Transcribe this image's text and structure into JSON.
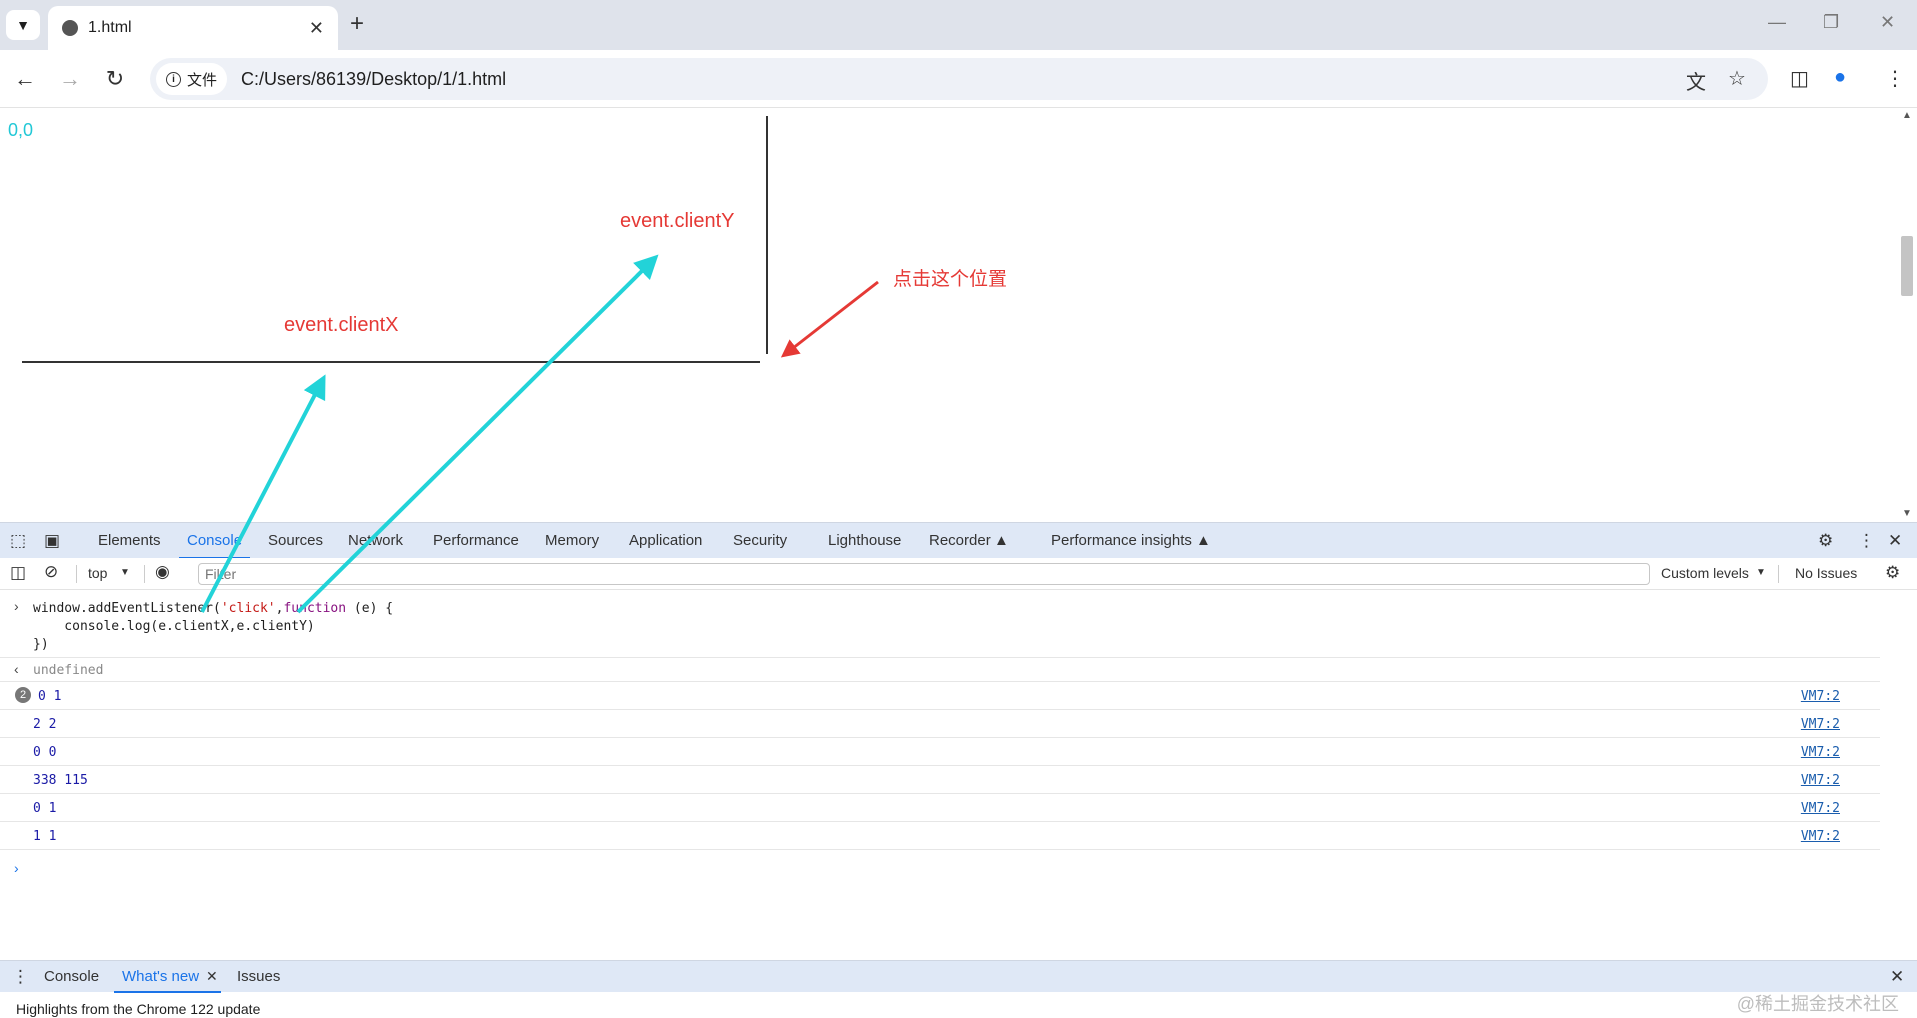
{
  "browser": {
    "tab_title": "1.html",
    "site_chip": "文件",
    "url": "C:/Users/86139/Desktop/1/1.html"
  },
  "page": {
    "coord_label": "0,0",
    "label_clienty": "event.clientY",
    "label_clientx": "event.clientX",
    "click_note": "点击这个位置"
  },
  "devtools": {
    "tabs": [
      "Elements",
      "Console",
      "Sources",
      "Network",
      "Performance",
      "Memory",
      "Application",
      "Security",
      "Lighthouse",
      "Recorder",
      "Performance insights"
    ],
    "active_tab": "Console",
    "context": "top",
    "filter_placeholder": "Filter",
    "levels": "Custom levels",
    "issues": "No Issues"
  },
  "console": {
    "code_line1_a": "window.addEventListener(",
    "code_line1_str": "'click'",
    "code_line1_b": ",",
    "code_line1_kw": "function",
    "code_line1_c": " (e) {",
    "code_line2": "    console.log(e.clientX,e.clientY)",
    "code_line3": "})",
    "result": "undefined",
    "logs": [
      {
        "text": "0 1",
        "count": "2",
        "source": "VM7:2"
      },
      {
        "text": "2 2",
        "source": "VM7:2"
      },
      {
        "text": "0 0",
        "source": "VM7:2"
      },
      {
        "text": "338 115",
        "source": "VM7:2"
      },
      {
        "text": "0 1",
        "source": "VM7:2"
      },
      {
        "text": "1 1",
        "source": "VM7:2"
      }
    ]
  },
  "drawer": {
    "tabs": [
      "Console",
      "What's new",
      "Issues"
    ],
    "active_tab": "What's new",
    "highlights": "Highlights from the Chrome 122 update"
  },
  "watermark": "@稀土掘金技术社区",
  "colors": {
    "cyan_arrow": "#22d3d8",
    "red_arrow": "#e53935",
    "accent": "#1a73e8"
  }
}
